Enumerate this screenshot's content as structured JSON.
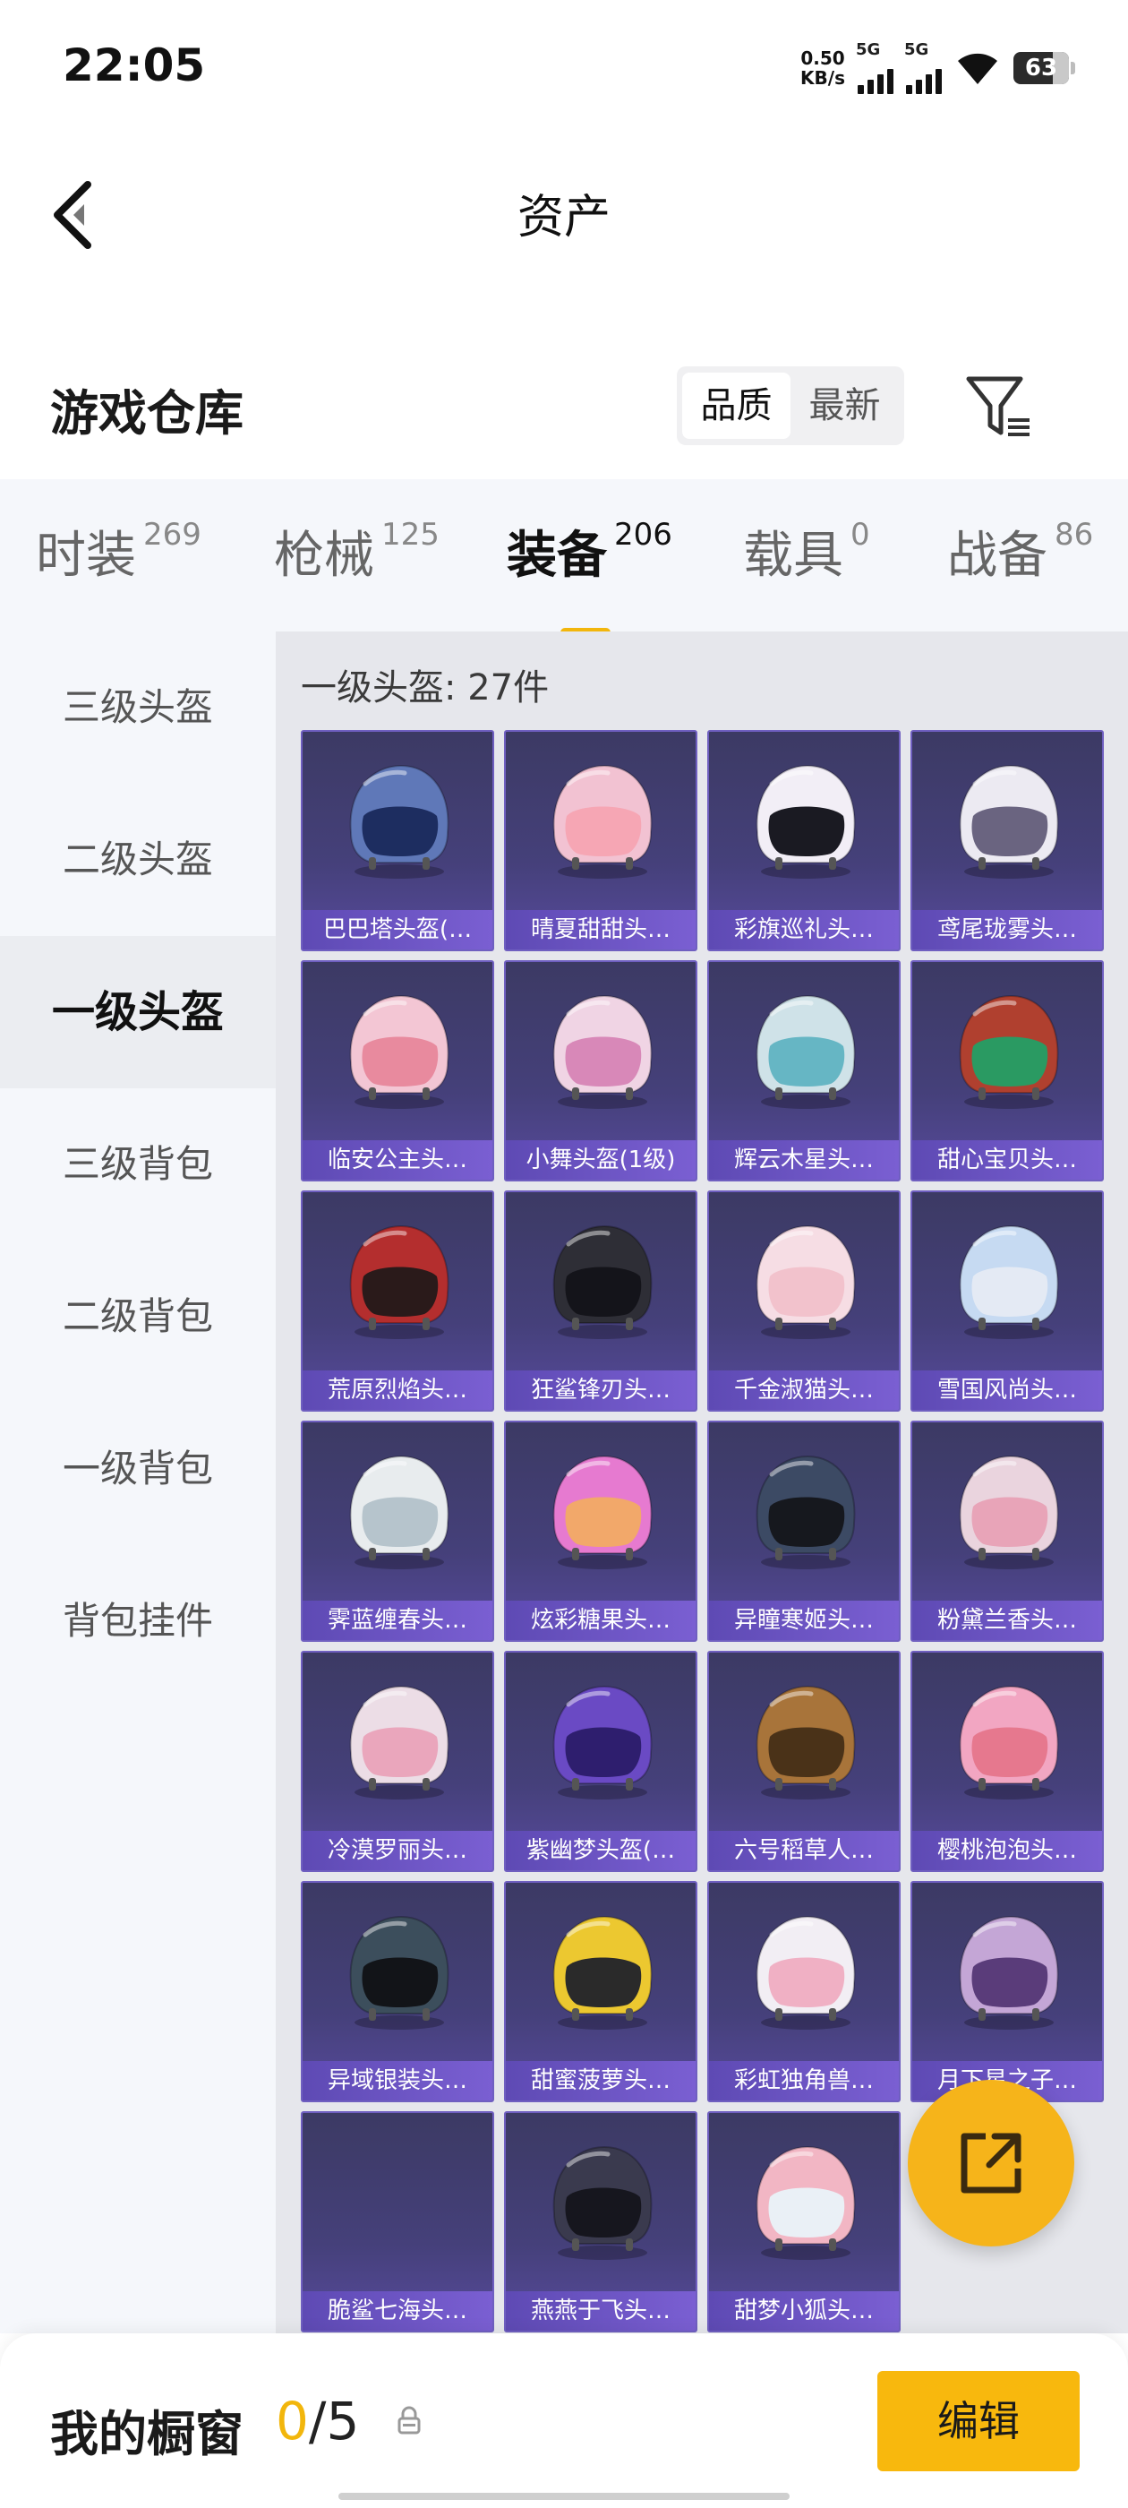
{
  "status_bar": {
    "time": "22:05",
    "net_speed": "0.50",
    "net_unit": "KB/s",
    "sim1": "5G",
    "sim2": "5G",
    "battery": "63"
  },
  "header": {
    "title": "资产",
    "back_icon": "chevron-left-icon"
  },
  "warehouse": {
    "title": "游戏仓库",
    "sort_options": [
      "品质",
      "最新"
    ],
    "selected_sort": "品质",
    "filter_icon": "filter-icon"
  },
  "categories": [
    {
      "name": "时装",
      "count": "269"
    },
    {
      "name": "枪械",
      "count": "125"
    },
    {
      "name": "装备",
      "count": "206"
    },
    {
      "name": "载具",
      "count": "0"
    },
    {
      "name": "战备",
      "count": "86"
    }
  ],
  "selected_category": "装备",
  "subcategories": [
    "三级头盔",
    "二级头盔",
    "一级头盔",
    "三级背包",
    "二级背包",
    "一级背包",
    "背包挂件"
  ],
  "selected_subcategory": "一级头盔",
  "grid_title": "一级头盔: 27件",
  "items": [
    {
      "label": "巴巴塔头盔(…",
      "color": "#5f78b8",
      "visor": "#1d2d60"
    },
    {
      "label": "晴夏甜甜头…",
      "color": "#f2c2d2",
      "visor": "#f6a6b4"
    },
    {
      "label": "彩旗巡礼头…",
      "color": "#f2eef6",
      "visor": "#1a1a22"
    },
    {
      "label": "鸢尾珑雾头…",
      "color": "#eceaf2",
      "visor": "#6a6480"
    },
    {
      "label": "临安公主头…",
      "color": "#f3c6d4",
      "visor": "#e88a9e"
    },
    {
      "label": "小舞头盔(1级)",
      "color": "#f0d4e4",
      "visor": "#d888b8"
    },
    {
      "label": "辉云木星头…",
      "color": "#cfe2e8",
      "visor": "#66b6c4"
    },
    {
      "label": "甜心宝贝头…",
      "color": "#b0402f",
      "visor": "#2a9a62"
    },
    {
      "label": "荒原烈焰头…",
      "color": "#b42e2e",
      "visor": "#2a1a1a"
    },
    {
      "label": "狂鲨锋刃头…",
      "color": "#2e2e36",
      "visor": "#14141a"
    },
    {
      "label": "千金淑猫头…",
      "color": "#f6dde4",
      "visor": "#f2c2cc"
    },
    {
      "label": "雪国风尚头…",
      "color": "#c6daf2",
      "visor": "#e4eaf4"
    },
    {
      "label": "霁蓝缠春头…",
      "color": "#e8ecee",
      "visor": "#b6c4cc"
    },
    {
      "label": "炫彩糖果头…",
      "color": "#e67ad0",
      "visor": "#f2a86a"
    },
    {
      "label": "异瞳寒姬头…",
      "color": "#3c4a64",
      "visor": "#16181e"
    },
    {
      "label": "粉黛兰香头…",
      "color": "#ead4de",
      "visor": "#e8a4b8"
    },
    {
      "label": "冷漠罗丽头…",
      "color": "#ecdde6",
      "visor": "#eaa6bc"
    },
    {
      "label": "紫幽梦头盔(…",
      "color": "#6a4ac4",
      "visor": "#2e1e6e"
    },
    {
      "label": "六号稻草人…",
      "color": "#a8743a",
      "visor": "#4a3218"
    },
    {
      "label": "樱桃泡泡头…",
      "color": "#f2a6c2",
      "visor": "#e6788e"
    },
    {
      "label": "异域银装头…",
      "color": "#3c4e5c",
      "visor": "#121418"
    },
    {
      "label": "甜蜜菠萝头…",
      "color": "#ecc830",
      "visor": "#2a2a2a"
    },
    {
      "label": "彩虹独角兽…",
      "color": "#f2eef4",
      "visor": "#f0b0c4"
    },
    {
      "label": "月下星之子…",
      "color": "#c4a6d6",
      "visor": "#5a3c7a"
    },
    {
      "label": "脆鲨七海头…",
      "color": "",
      "visor": ""
    },
    {
      "label": "燕燕于飞头…",
      "color": "#3a3a4e",
      "visor": "#16161e"
    },
    {
      "label": "甜梦小狐头…",
      "color": "#f2b6c4",
      "visor": "#eaf0f6"
    }
  ],
  "share_icon": "share-icon",
  "bottom": {
    "showcase_label": "我的橱窗",
    "count_current": "0",
    "count_total": "/5",
    "lock_icon": "lock-icon",
    "edit_label": "编辑"
  },
  "colors": {
    "accent": "#f2b60c",
    "card_label": "#6b54c4"
  }
}
